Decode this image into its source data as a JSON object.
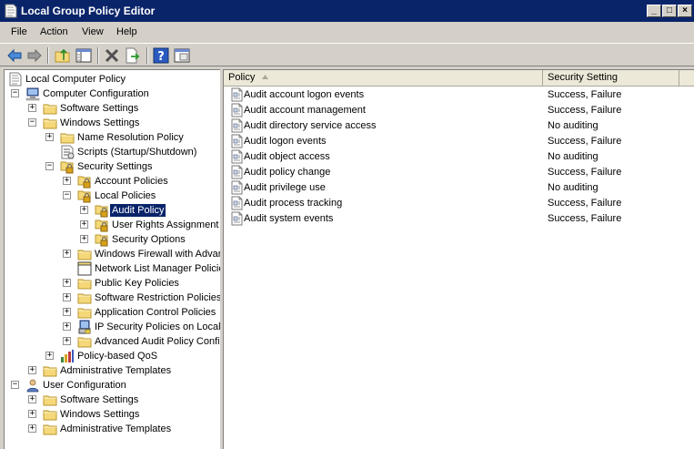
{
  "window": {
    "title": "Local Group Policy Editor",
    "buttons": {
      "minimize": "_",
      "maximize": "□",
      "close": "×"
    }
  },
  "menu": [
    "File",
    "Action",
    "View",
    "Help"
  ],
  "toolbar": [
    "back-icon",
    "forward-icon",
    "up-folder-icon",
    "show-hide-tree-icon",
    "delete-icon",
    "export-list-icon",
    "help-icon",
    "properties-icon"
  ],
  "tree": {
    "root": "Local Computer Policy",
    "computer_configuration": "Computer Configuration",
    "cc_software_settings": "Software Settings",
    "cc_windows_settings": "Windows Settings",
    "name_resolution_policy": "Name Resolution Policy",
    "scripts": "Scripts (Startup/Shutdown)",
    "security_settings": "Security Settings",
    "account_policies": "Account Policies",
    "local_policies": "Local Policies",
    "audit_policy": "Audit Policy",
    "user_rights_assignment": "User Rights Assignment",
    "security_options": "Security Options",
    "windows_firewall": "Windows Firewall with Advanced Security",
    "network_list_manager": "Network List Manager Policies",
    "public_key_policies": "Public Key Policies",
    "software_restriction": "Software Restriction Policies",
    "application_control": "Application Control Policies",
    "ip_security": "IP Security Policies on Local Computer",
    "advanced_audit": "Advanced Audit Policy Configuration",
    "policy_based_qos": "Policy-based QoS",
    "cc_admin_templates": "Administrative Templates",
    "user_configuration": "User Configuration",
    "uc_software_settings": "Software Settings",
    "uc_windows_settings": "Windows Settings",
    "uc_admin_templates": "Administrative Templates"
  },
  "list": {
    "headers": {
      "policy": "Policy",
      "setting": "Security Setting"
    },
    "rows": [
      {
        "policy": "Audit account logon events",
        "setting": "Success, Failure"
      },
      {
        "policy": "Audit account management",
        "setting": "Success, Failure"
      },
      {
        "policy": "Audit directory service access",
        "setting": "No auditing"
      },
      {
        "policy": "Audit logon events",
        "setting": "Success, Failure"
      },
      {
        "policy": "Audit object access",
        "setting": "No auditing"
      },
      {
        "policy": "Audit policy change",
        "setting": "Success, Failure"
      },
      {
        "policy": "Audit privilege use",
        "setting": "No auditing"
      },
      {
        "policy": "Audit process tracking",
        "setting": "Success, Failure"
      },
      {
        "policy": "Audit system events",
        "setting": "Success, Failure"
      }
    ]
  },
  "colors": {
    "titlebar": "#0a246a",
    "selection": "#0a246a",
    "folder": "#f5d87a",
    "lock": "#d8a21c"
  }
}
